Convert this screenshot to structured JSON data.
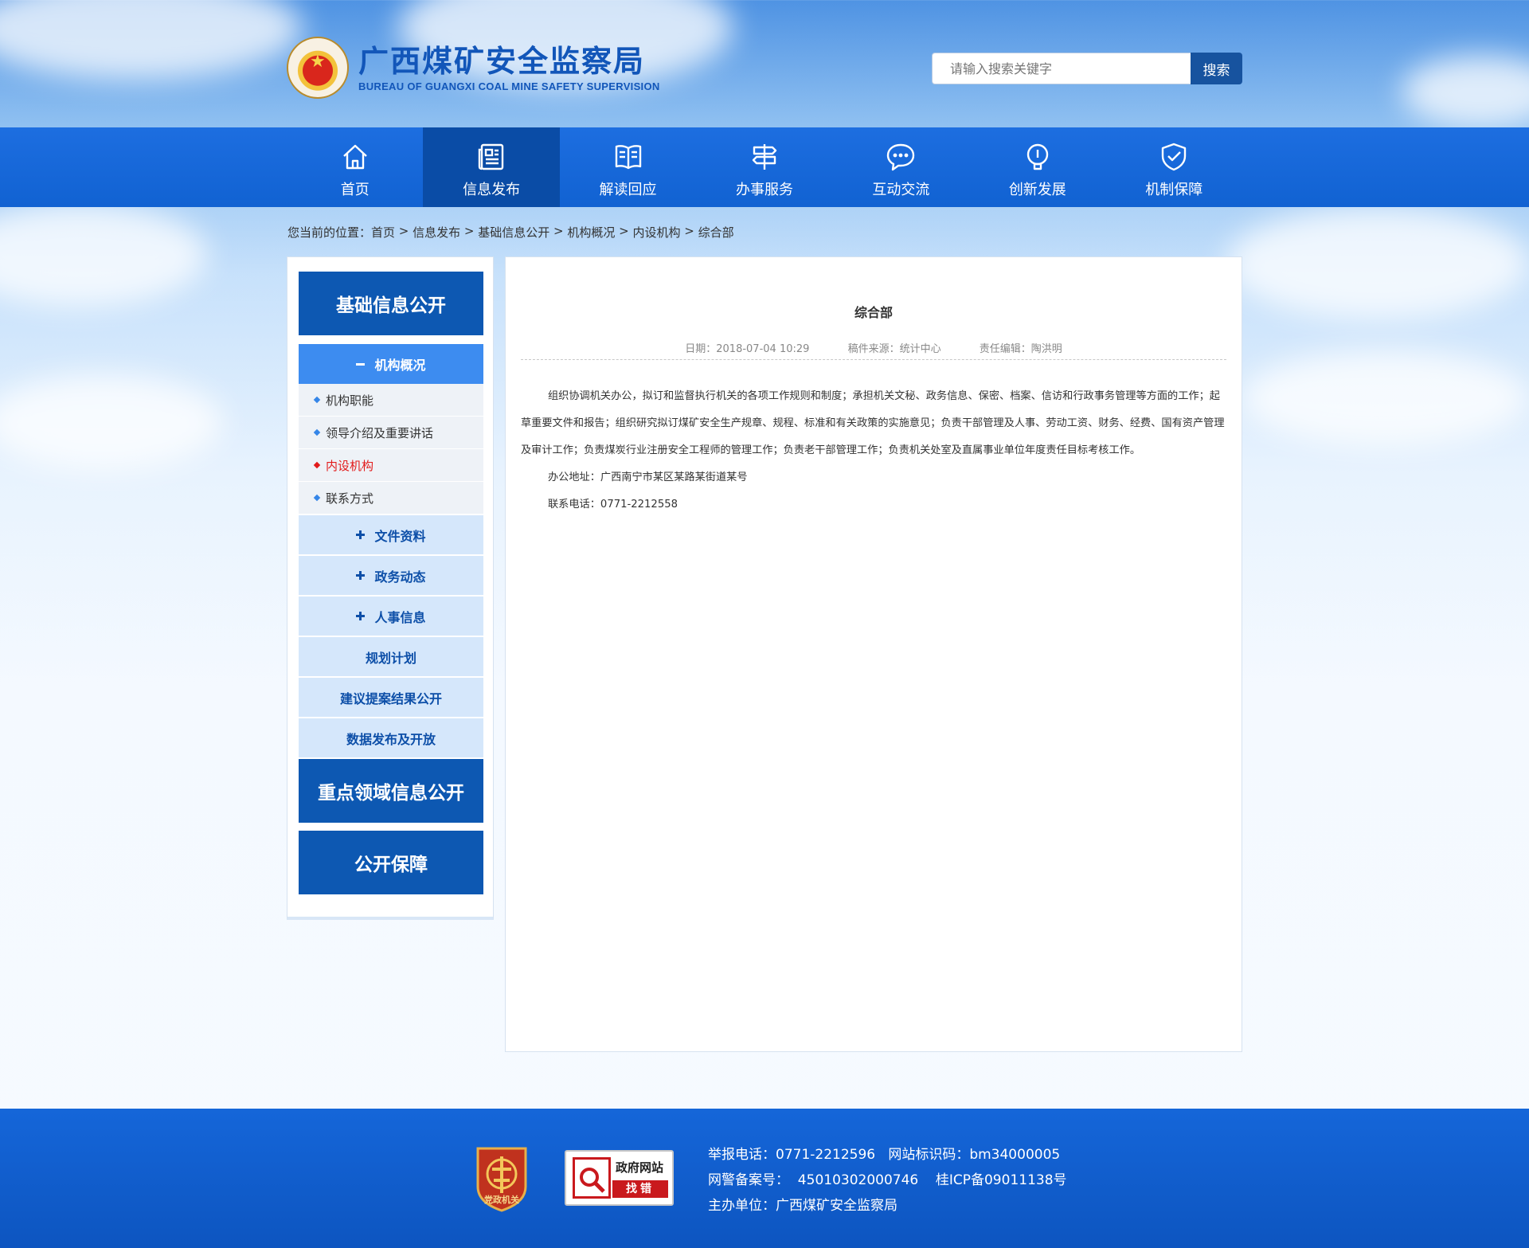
{
  "header": {
    "title_cn": "广西煤矿安全监察局",
    "title_en": "BUREAU OF GUANGXI COAL MINE SAFETY SUPERVISION",
    "logo_icon": "national-emblem-icon",
    "search_placeholder": "请输入搜索关键字",
    "search_button": "搜索"
  },
  "nav": {
    "items": [
      {
        "label": "首页",
        "icon": "home-icon"
      },
      {
        "label": "信息发布",
        "icon": "newspaper-icon",
        "active": true
      },
      {
        "label": "解读回应",
        "icon": "book-icon"
      },
      {
        "label": "办事服务",
        "icon": "signpost-icon"
      },
      {
        "label": "互动交流",
        "icon": "chat-icon"
      },
      {
        "label": "创新发展",
        "icon": "lightbulb-icon"
      },
      {
        "label": "机制保障",
        "icon": "shield-check-icon"
      }
    ],
    "bg_color": "#1566d9",
    "active_color": "#0a4ca6"
  },
  "breadcrumb": {
    "prefix": "您当前的位置：",
    "items": [
      "首页",
      "信息发布",
      "基础信息公开",
      "机构概况",
      "内设机构",
      "综合部"
    ],
    "separator": " > "
  },
  "sidebar": {
    "section1": "基础信息公开",
    "open_category": "机构概况",
    "sub_items": [
      "机构职能",
      "领导介绍及重要讲话",
      "内设机构",
      "联系方式"
    ],
    "active_sub": "内设机构",
    "categories": [
      "文件资料",
      "政务动态",
      "人事信息"
    ],
    "plain_categories": [
      "规划计划",
      "建议提案结果公开",
      "数据发布及开放"
    ],
    "section2": "重点领域信息公开",
    "section3": "公开保障"
  },
  "article": {
    "title": "综合部",
    "date": "日期：2018-07-04 10:29",
    "source": "稿件来源：统计中心",
    "editor": "责任编辑：陶洪明",
    "paragraph": "组织协调机关办公，拟订和监督执行机关的各项工作规则和制度；承担机关文秘、政务信息、保密、档案、信访和行政事务管理等方面的工作；起草重要文件和报告；组织研究拟订煤矿安全生产规章、规程、标准和有关政策的实施意见；负责干部管理及人事、劳动工资、财务、经费、国有资产管理及审计工作；负责煤炭行业注册安全工程师的管理工作；负责老干部管理工作；负责机关处室及直属事业单位年度责任目标考核工作。",
    "address": "办公地址：广西南宁市某区某路某街道某号",
    "phone": "联系电话：0771-2212558"
  },
  "footer": {
    "report_phone": "举报电话：0771-2212596",
    "site_code": "网站标识码：bm34000005",
    "police_record": "网警备案号：  45010302000746",
    "icp": "桂ICP备09011138号",
    "sponsor": "主办单位：广西煤矿安全监察局",
    "badge1_label": "党政机关",
    "badge2_line1": "政府网站",
    "badge2_line2": "找错"
  }
}
